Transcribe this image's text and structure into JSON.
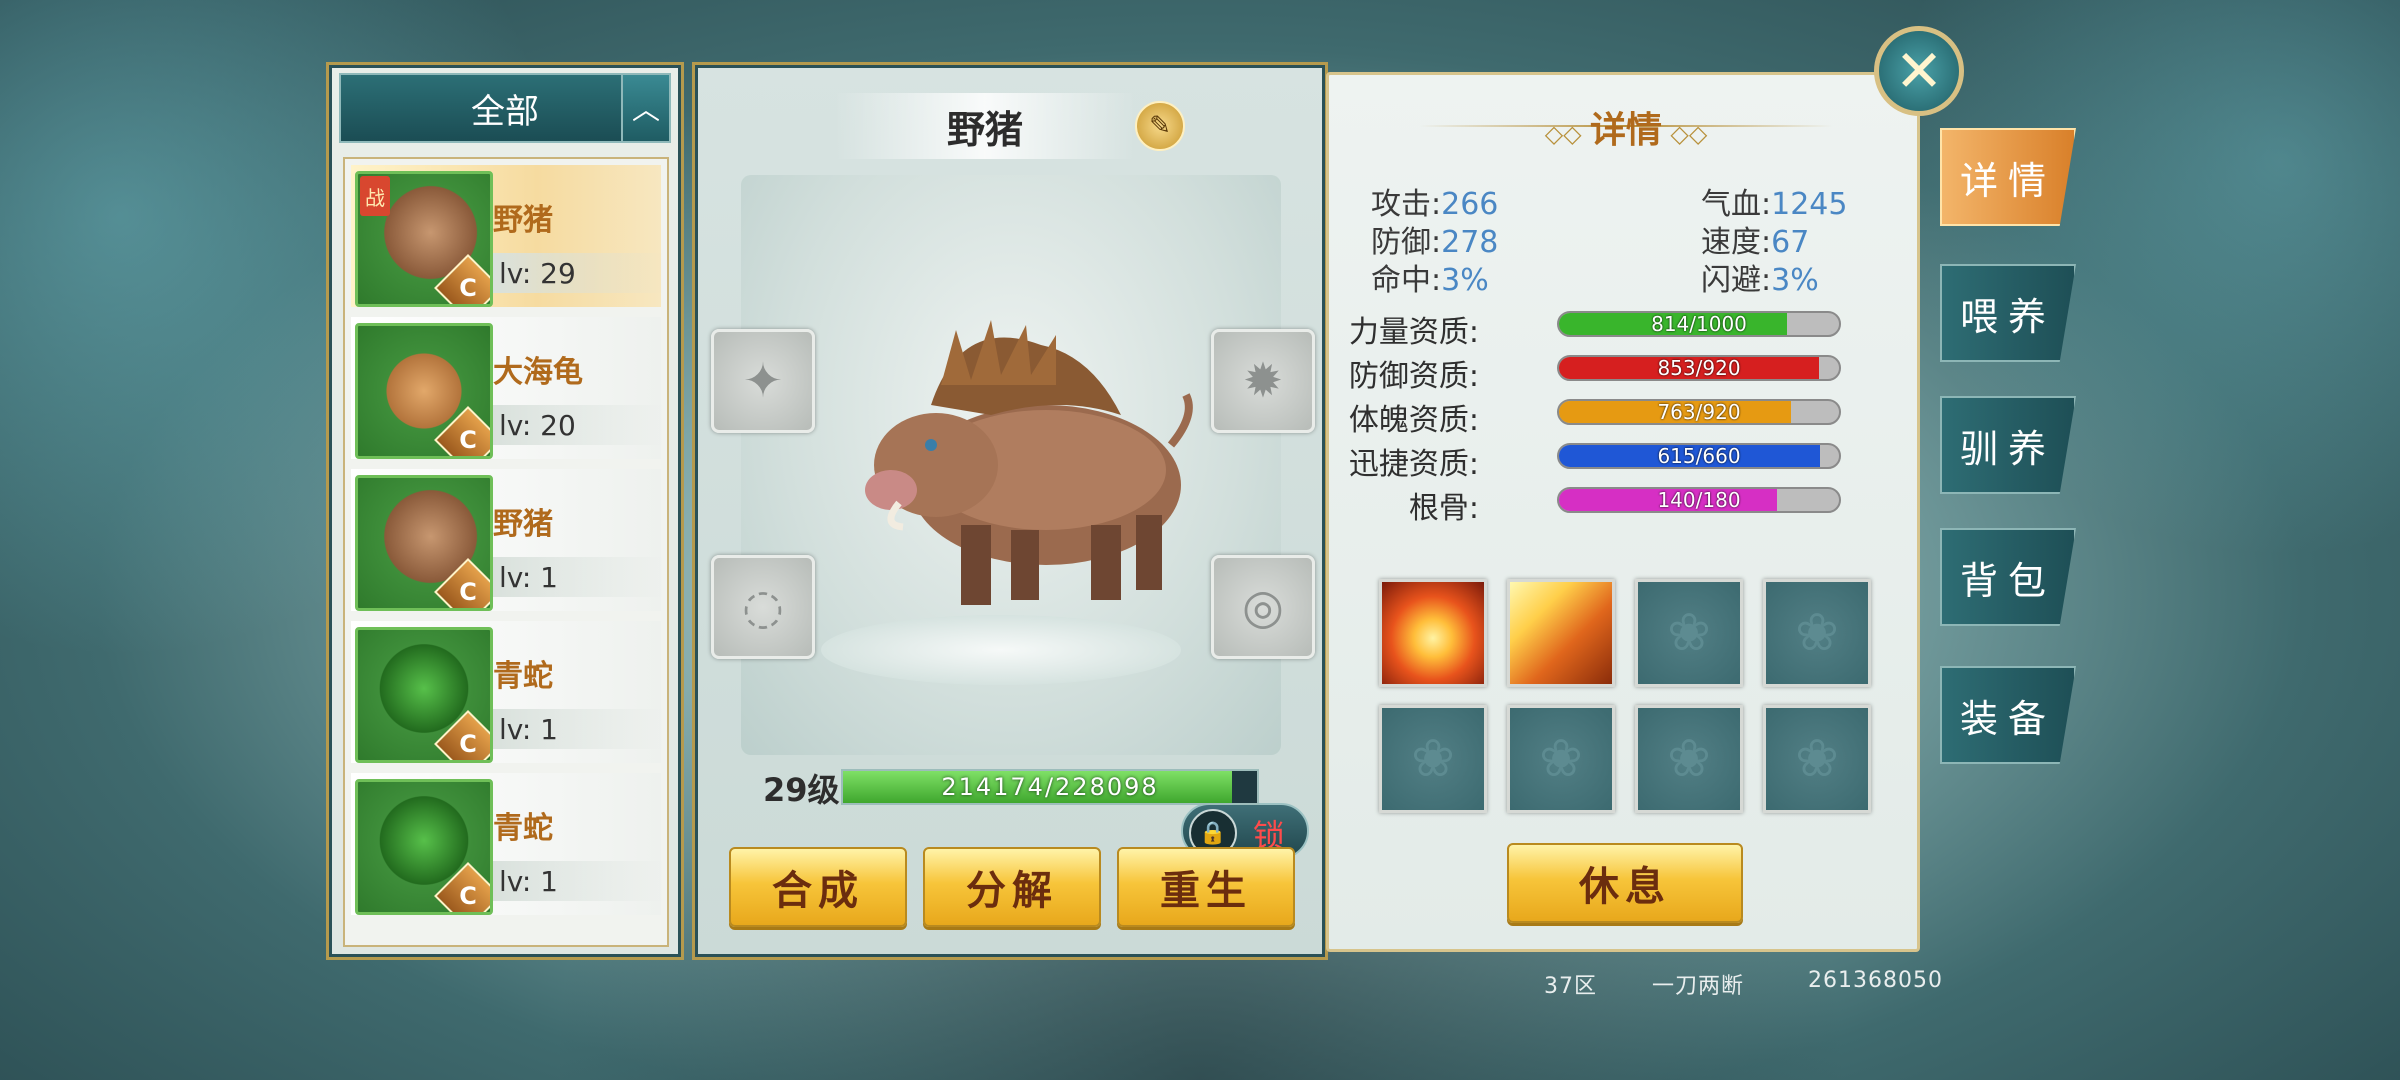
{
  "list": {
    "filter_label": "全部",
    "toggle_glyph": "︿",
    "items": [
      {
        "name": "野猪",
        "level": "lv: 29",
        "grade": "C",
        "tag": "战",
        "kind": "boar"
      },
      {
        "name": "大海龟",
        "level": "lv: 20",
        "grade": "C",
        "tag": "",
        "kind": "turtle"
      },
      {
        "name": "野猪",
        "level": "lv: 1",
        "grade": "C",
        "tag": "",
        "kind": "boar"
      },
      {
        "name": "青蛇",
        "level": "lv: 1",
        "grade": "C",
        "tag": "",
        "kind": "snake"
      },
      {
        "name": "青蛇",
        "level": "lv: 1",
        "grade": "C",
        "tag": "",
        "kind": "snake"
      }
    ]
  },
  "pet": {
    "name": "野猪",
    "lock_label": "锁",
    "level_label": "29级",
    "exp_text": "214174/228098",
    "exp_fraction": 0.939
  },
  "actions": {
    "compose": "合成",
    "decompose": "分解",
    "rebirth": "重生",
    "rest": "休息"
  },
  "details": {
    "title": "详情",
    "stats": {
      "attack_label": "攻击:",
      "attack": "266",
      "defense_label": "防御:",
      "defense": "278",
      "hit_label": "命中:",
      "hit": "3%",
      "hp_label": "气血:",
      "hp": "1245",
      "speed_label": "速度:",
      "speed": "67",
      "dodge_label": "闪避:",
      "dodge": "3%"
    },
    "aptitudes": [
      {
        "label": "力量资质:",
        "text": "814/1000",
        "fraction": 0.814,
        "color": "#39b52c"
      },
      {
        "label": "防御资质:",
        "text": "853/920",
        "fraction": 0.927,
        "color": "#d61f1f"
      },
      {
        "label": "体魄资质:",
        "text": "763/920",
        "fraction": 0.829,
        "color": "#e69a12"
      },
      {
        "label": "迅捷资质:",
        "text": "615/660",
        "fraction": 0.932,
        "color": "#1f57d6"
      },
      {
        "label": "根骨:",
        "text": "140/180",
        "fraction": 0.778,
        "color": "#d62fc4"
      }
    ]
  },
  "side_tabs": [
    "详情",
    "喂养",
    "驯养",
    "背包",
    "装备"
  ],
  "footer": {
    "server": "37区",
    "player": "一刀两断",
    "id": "261368050"
  }
}
